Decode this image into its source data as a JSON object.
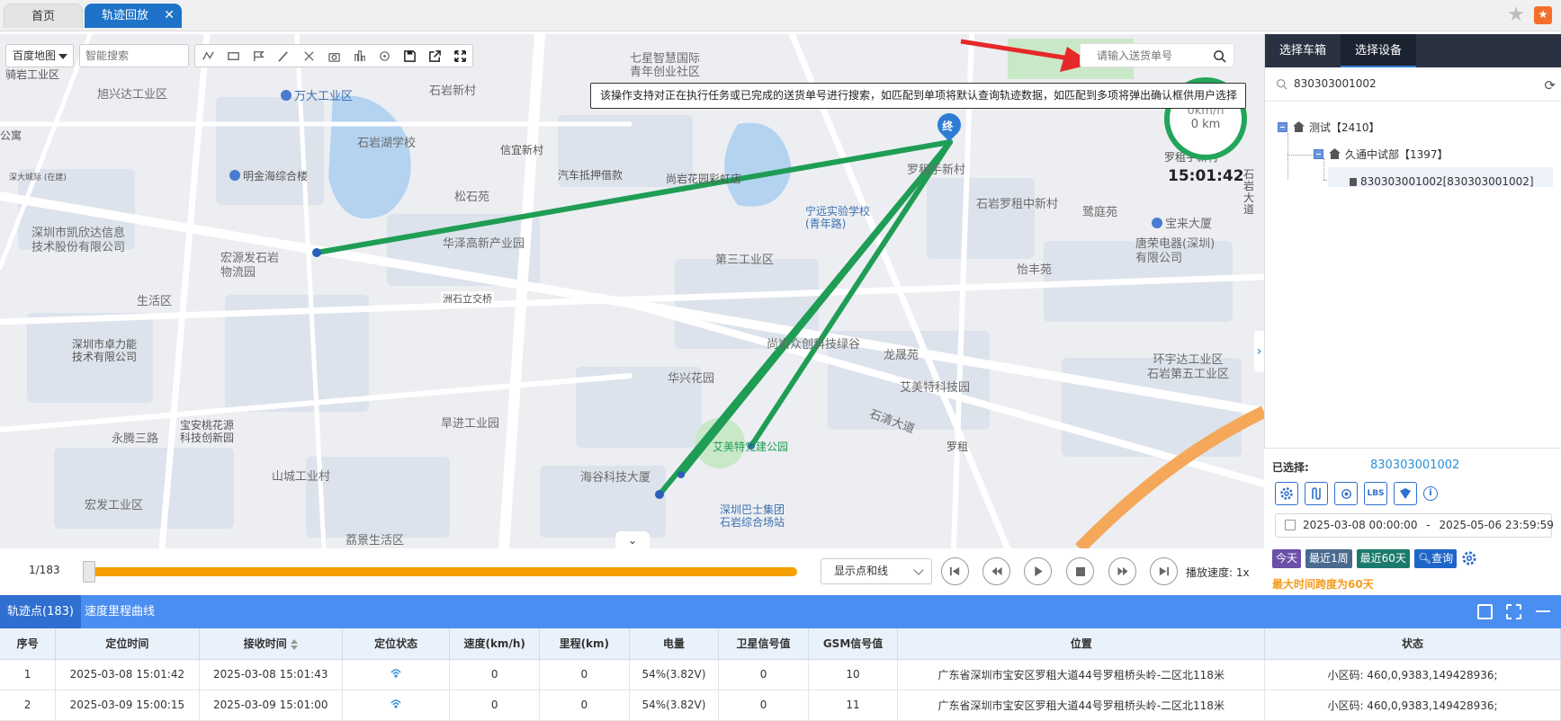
{
  "tabs": {
    "home": "首页",
    "active": "轨迹回放",
    "close": "✕"
  },
  "map": {
    "map_type": "百度地图",
    "smart_search_placeholder": "智能搜索",
    "delivery_search_placeholder": "请输入送货单号",
    "tooltip": "该操作支持对正在执行任务或已完成的送货单号进行搜索，如匹配到单项将默认查询轨迹数据，如匹配到多项将弹出确认框供用户选择",
    "speed": "0km/h",
    "mileage": "0 km",
    "time": "15:01:42",
    "end_marker": "终",
    "collapse_glyph": "⌄",
    "side_toggle_glyph": "›",
    "labels": [
      "骑岩工业区",
      "旭兴达工业区",
      "万大工业区",
      "石岩湖学校",
      "明金海综合楼",
      "公寓",
      "深大城际\n(在建)",
      "深圳市凯欣达信息\n技术股份有限公司",
      "宏源发石岩\n物流园",
      "生活区",
      "深圳市卓力能\n技术有限公司",
      "宝安桃花源\n科技创新园",
      "永腾三路",
      "山城工业村",
      "宏发工业区",
      "荔景生活区",
      "七星智慧国际\n青年创业社区",
      "石岩新村",
      "信宜新村",
      "汽车抵押借款",
      "松石苑",
      "华泽高新产业园",
      "洲石立交桥",
      "第三工业区",
      "旱进工业园",
      "华兴花园",
      "海谷科技大厦",
      "尚岩花园彩虹店",
      "宁远实验学校\n(青年路)",
      "罗租手新村",
      "石岩罗租中新村",
      "鹭庭苑",
      "宝来大厦",
      "唐荣电器(深圳)\n有限公司",
      "怡丰苑",
      "龙晟苑",
      "艾美特科技园",
      "环宇达工业区\n石岩第五工业区",
      "石清大道",
      "罗租",
      "艾美特党建公园",
      "深圳巴士集团\n石岩综合场站",
      "尚岩众创科技绿谷",
      "罗租手新村",
      "石岩大道"
    ]
  },
  "playback": {
    "counter": "1/183",
    "display_mode": "显示点和线",
    "speed_label": "播放速度: 1x",
    "progress_fraction": 0.005
  },
  "table": {
    "tab_points": "轨迹点(183)",
    "tab_curve": "速度里程曲线",
    "headers": [
      "序号",
      "定位时间",
      "接收时间",
      "定位状态",
      "速度(km/h)",
      "里程(km)",
      "电量",
      "卫星信号值",
      "GSM信号值",
      "位置",
      "状态"
    ],
    "rows": [
      [
        "1",
        "2025-03-08 15:01:42",
        "2025-03-08 15:01:43",
        "",
        "0",
        "0",
        "54%(3.82V)",
        "0",
        "10",
        "广东省深圳市宝安区罗租大道44号罗租桥头岭-二区北118米",
        "小区码: 460,0,9383,149428936;"
      ],
      [
        "2",
        "2025-03-09 15:00:15",
        "2025-03-09 15:01:00",
        "",
        "0",
        "0",
        "54%(3.82V)",
        "0",
        "11",
        "广东省深圳市宝安区罗租大道44号罗租桥头岭-二区北118米",
        "小区码: 460,0,9383,149428936;"
      ]
    ]
  },
  "right_panel": {
    "tab_box": "选择车箱",
    "tab_device": "选择设备",
    "search_value": "830303001002",
    "tree": {
      "root": "测试【2410】",
      "child": "久通中试部【1397】",
      "leaf": "830303001002[830303001002]"
    },
    "selected_label": "已选择:",
    "selected_value": "830303001002",
    "icon_buttons": [
      "gear-icon",
      "route-icon",
      "locate-icon",
      "lbs-icon",
      "shield-icon"
    ],
    "lbs_text": "LBS",
    "info_glyph": "i",
    "date_from": "2025-03-08 00:00:00",
    "date_sep": "-",
    "date_to": "2025-05-06 23:59:59",
    "quick": [
      "今天",
      "最近1周",
      "最近60天",
      "查询"
    ],
    "range_note": "最大时间跨度为60天",
    "colors": {
      "today": "#6b4fa8",
      "week": "#4a6a90",
      "sixty": "#1b7a6b",
      "query": "#1f65c9"
    }
  }
}
